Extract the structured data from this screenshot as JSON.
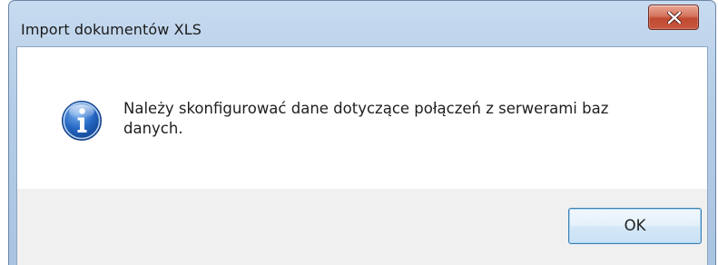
{
  "window": {
    "title": "Import dokumentów XLS",
    "close_glyph": "X"
  },
  "dialog": {
    "icon": "information-icon",
    "message": "Należy skonfigurować dane dotyczące połączeń z serwerami baz danych.",
    "ok_label": "OK"
  },
  "colors": {
    "title_bar": "#b9d1ea",
    "close_button": "#c75a42",
    "dialog_body": "#ffffff",
    "button_area": "#f0f0f0",
    "ok_border": "#3c7fb1",
    "info_icon": "#1f5fb4"
  }
}
